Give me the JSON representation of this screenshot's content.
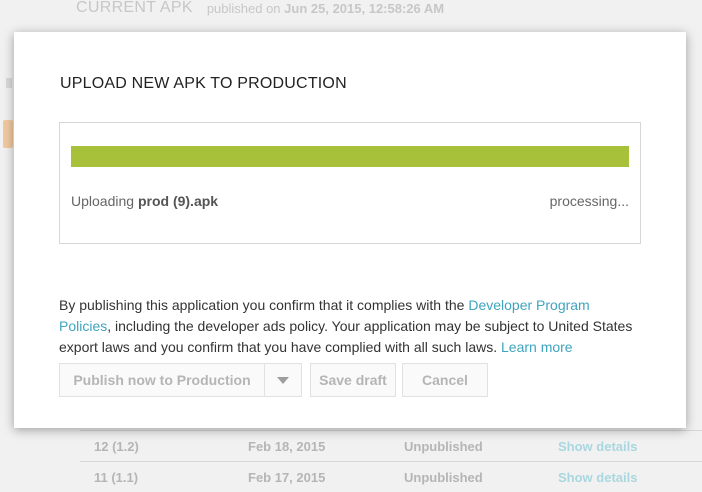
{
  "background": {
    "current_apk_label": "CURRENT APK",
    "published_prefix": "published on",
    "published_date": "Jun 25, 2015, 12:58:26 AM",
    "rows": [
      {
        "version": "12 (1.2)",
        "date": "Feb 18, 2015",
        "status": "Unpublished",
        "action": "Show details"
      },
      {
        "version": "11 (1.1)",
        "date": "Feb 17, 2015",
        "status": "Unpublished",
        "action": "Show details"
      }
    ]
  },
  "modal": {
    "title": "UPLOAD NEW APK TO PRODUCTION",
    "upload": {
      "status_prefix": "Uploading",
      "file_name": "prod (9).apk",
      "processing_text": "processing...",
      "progress_percent": 100
    },
    "policy": {
      "text_before_link": "By publishing this application you confirm that it complies with the ",
      "policy_link": "Developer Program Policies",
      "text_middle": ", including the developer ads policy. Your application may be subject to United States export laws and you confirm that you have complied with all such laws. ",
      "learn_more_link": "Learn more"
    },
    "buttons": {
      "publish": "Publish now to Production",
      "save_draft": "Save draft",
      "cancel": "Cancel"
    }
  },
  "colors": {
    "progress": "#a8c13a",
    "link": "#3fa4bf"
  }
}
